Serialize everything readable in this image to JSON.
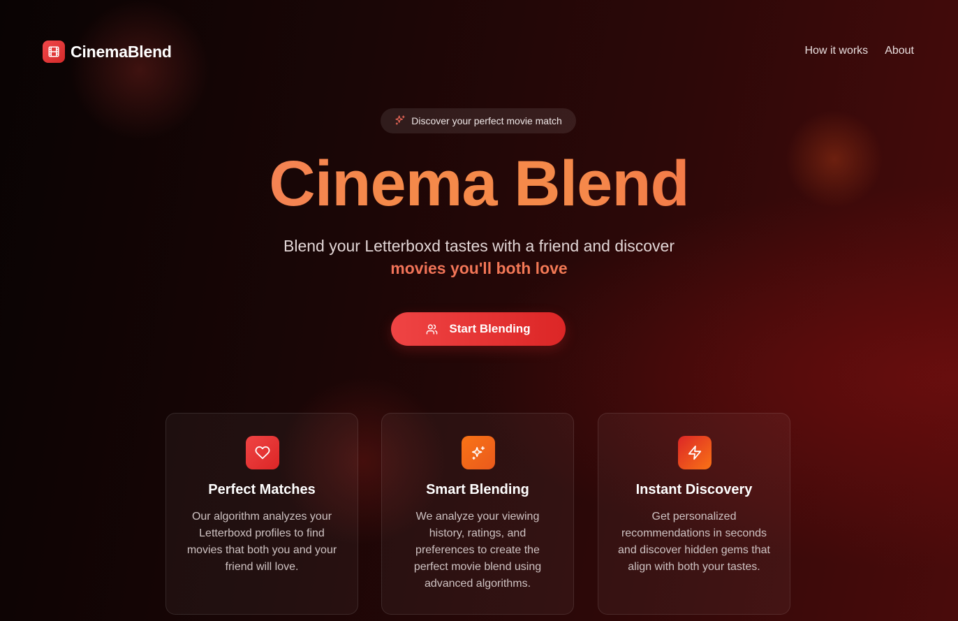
{
  "header": {
    "brand": "CinemaBlend",
    "brand_icon": "film-icon",
    "nav": [
      {
        "label": "How it works"
      },
      {
        "label": "About"
      }
    ]
  },
  "hero": {
    "badge": {
      "icon": "sparkles-icon",
      "text": "Discover your perfect movie match"
    },
    "title": "Cinema Blend",
    "subtitle_line1": "Blend your Letterboxd tastes with a friend and discover",
    "subtitle_line2": "movies you'll both love",
    "cta": {
      "icon": "users-icon",
      "label": "Start Blending"
    }
  },
  "features": [
    {
      "icon": "heart-icon",
      "title": "Perfect Matches",
      "description": "Our algorithm analyzes your Letterboxd profiles to find movies that both you and your friend will love."
    },
    {
      "icon": "sparkles-icon",
      "title": "Smart Blending",
      "description": "We analyze your viewing history, ratings, and preferences to create the perfect movie blend using advanced algorithms."
    },
    {
      "icon": "zap-icon",
      "title": "Instant Discovery",
      "description": "Get personalized recommendations in seconds and discover hidden gems that align with both your tastes."
    }
  ],
  "colors": {
    "accent_red": "#ef4444",
    "accent_orange": "#f5894a",
    "background_dark": "#0a0303",
    "background_red": "#4a0b0b"
  }
}
